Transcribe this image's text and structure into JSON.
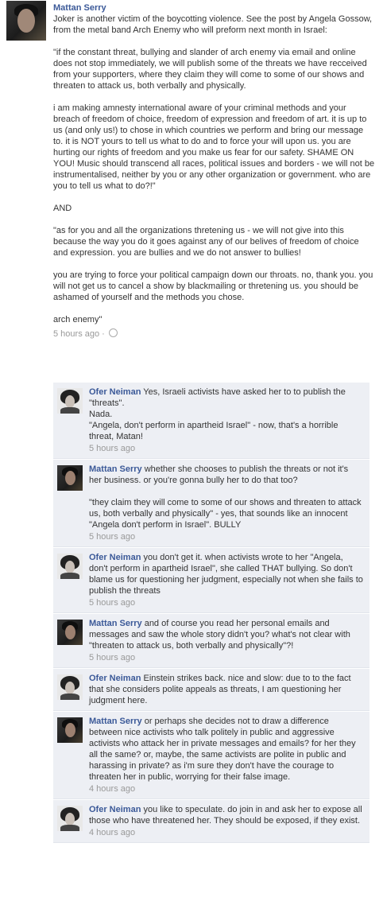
{
  "post": {
    "author": "Mattan Serry",
    "paragraphs": [
      [
        "Joker is another victim of the boycotting violence. See the post by Angela Gossow, from the metal band Arch Enemy who will preform next month in Israel:"
      ],
      [
        "\"if the constant threat, bullying and slander of arch enemy via email and online does not stop immediately, we will publish some of the threats we have recceived from your supporters, where they claim they will come to some of our shows and threaten to attack us, both verbally and physically."
      ],
      [
        "i am making amnesty international aware of your criminal methods and your breach of freedom of choice, freedom of expression and freedom of art. it is up to us (and only us!) to chose in which countries we perform and bring our message to. it is NOT yours to tell us what to do and to force your will upon us. you are hurting our rights of freedom and you make us fear for our safety. SHAME ON YOU! Music should transcend all races, political issues and borders - we will not be instrumentalised, neither by you or any other organization or government. who are you to tell us what to do?!\""
      ],
      [
        "AND"
      ],
      [
        "\"as for you and all the organizations thretening us - we will not give into this because the way you do it goes against any of our belives of freedom of choice and expression. you are bullies and we do not answer to bullies!"
      ],
      [
        "you are trying to force your political campaign down our throats. no, thank you. you will not get us to cancel a show by blackmailing or thretening us. you should be ashamed of yourself and the methods you chose."
      ],
      [
        "arch enemy\""
      ]
    ],
    "time": "5 hours ago"
  },
  "comments": [
    {
      "author": "Ofer Neiman",
      "avatar": "ofer",
      "lines": [
        "Yes, Israeli activists have asked her to to publish the \"threats\".",
        "Nada.",
        "\"Angela, don't perform in apartheid Israel\" - now, that's a horrible threat, Matan!"
      ],
      "time": "5 hours ago"
    },
    {
      "author": "Mattan Serry",
      "avatar": "mattan",
      "lines": [
        "whether she chooses to publish the threats or not it's her business. or you're gonna bully her to do that too?",
        "",
        "\"they claim they will come to some of our shows and threaten to attack us, both verbally and physically\" - yes, that sounds like an innocent \"Angela don't perform in Israel\". BULLY"
      ],
      "time": "5 hours ago"
    },
    {
      "author": "Ofer Neiman",
      "avatar": "ofer",
      "lines": [
        "you don't get it. when activists wrote to her \"Angela, don't perform in apartheid Israel\", she called THAT bullying. So don't blame us for questioning her judgment, especially not when she fails to publish the threats"
      ],
      "time": "5 hours ago"
    },
    {
      "author": "Mattan Serry",
      "avatar": "mattan",
      "lines": [
        "and of course you read her personal emails and messages and saw the whole story didn't you? what's not clear with \"threaten to attack us, both verbally and physically\"?!"
      ],
      "time": "5 hours ago"
    },
    {
      "author": "Ofer Neiman",
      "avatar": "ofer",
      "lines": [
        "Einstein strikes back. nice and slow: due to to the fact that she considers polite appeals as threats, I am questioning her judgment here."
      ],
      "time": ""
    },
    {
      "author": "Mattan Serry",
      "avatar": "mattan",
      "lines": [
        "or perhaps she decides not to draw a difference between nice activists who talk politely in public and aggressive activists who attack her in private messages and emails? for her they all the same? or, maybe, the same activists are polite in public and harassing in private? as i'm sure they don't have the courage to threaten her in public, worrying for their false image."
      ],
      "time": "4 hours ago"
    },
    {
      "author": "Ofer Neiman",
      "avatar": "ofer",
      "lines": [
        "you like to speculate. do join in and ask her to expose all those who have threatened her. They should be exposed, if they exist."
      ],
      "time": "4 hours ago"
    }
  ]
}
